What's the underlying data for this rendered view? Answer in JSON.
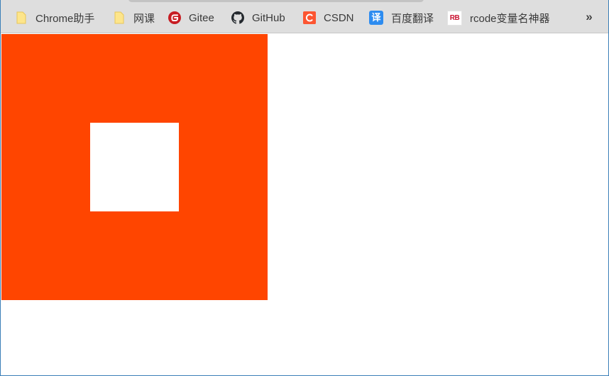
{
  "bookmarks": [
    {
      "label": "Chrome助手",
      "icon": "folder-icon"
    },
    {
      "label": "网课",
      "icon": "folder-icon"
    },
    {
      "label": "Gitee",
      "icon": "gitee-icon"
    },
    {
      "label": "GitHub",
      "icon": "github-icon"
    },
    {
      "label": "CSDN",
      "icon": "csdn-icon"
    },
    {
      "label": "百度翻译",
      "icon": "baidu-translate-icon",
      "icon_text": "译"
    },
    {
      "label": "rcode变量名神器",
      "icon": "rcode-icon",
      "icon_text": "RB"
    }
  ],
  "overflow_label": "»",
  "colors": {
    "outer_box": "#ff4500",
    "inner_box": "#ffffff",
    "bookmarks_bar": "#dedede",
    "gitee": "#c71d23",
    "csdn": "#fc5531",
    "baidu_translate": "#2d8cf0"
  }
}
